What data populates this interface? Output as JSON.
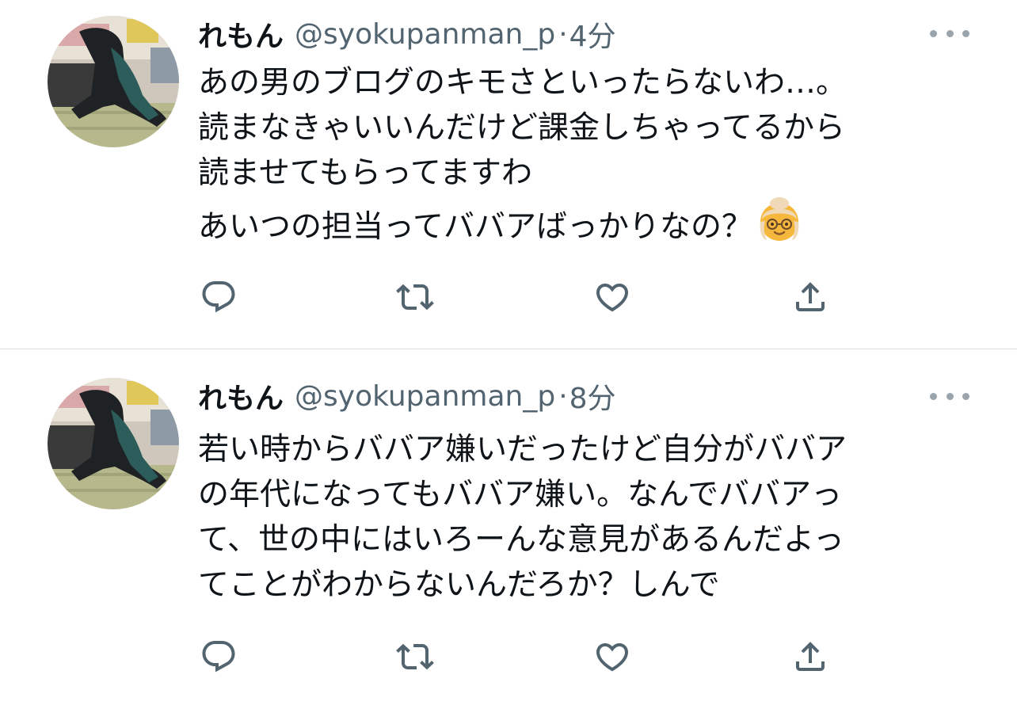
{
  "tweets": [
    {
      "display_name": "れもん",
      "handle": "@syokupanman_p",
      "separator": "·",
      "time": "4分",
      "lines": [
        "あの男のブログのキモさといったらないわ…。",
        "読まなきゃいいんだけど課金しちゃってるから",
        "読ませてもらってますわ",
        "あいつの担当ってババアばっかりなの？"
      ],
      "emoji": "older-woman-emoji"
    },
    {
      "display_name": "れもん",
      "handle": "@syokupanman_p",
      "separator": "·",
      "time": "8分",
      "lines": [
        "若い時からババア嫌いだったけど自分がババア",
        "の年代になってもババア嫌い。なんでババアっ",
        "て、世の中にはいろーんな意見があるんだよっ",
        "てことがわからないんだろか？しんで"
      ]
    }
  ],
  "icons": {
    "more": "more-horizontal-icon",
    "reply": "reply-icon",
    "retweet": "retweet-icon",
    "like": "heart-icon",
    "share": "share-icon"
  },
  "colors": {
    "text": "#0f1419",
    "secondary": "#536471",
    "divider": "#dcdfe2"
  }
}
